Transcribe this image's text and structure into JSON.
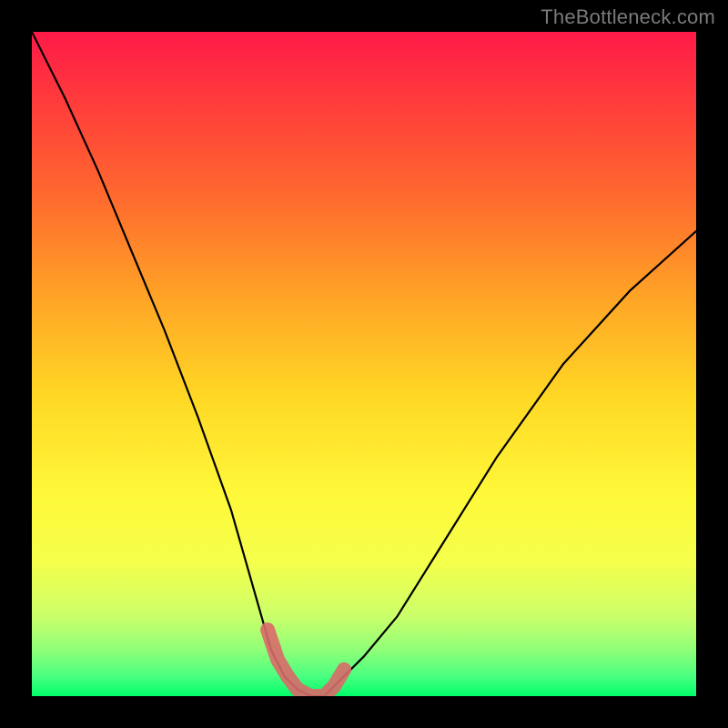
{
  "watermark": "TheBottleneck.com",
  "chart_data": {
    "type": "line",
    "title": "",
    "xlabel": "",
    "ylabel": "",
    "xlim": [
      0,
      100
    ],
    "ylim": [
      0,
      100
    ],
    "grid": false,
    "legend": false,
    "background_gradient": {
      "top": "#ff1a48",
      "mid": "#fff93a",
      "bottom": "#00ff6a"
    },
    "series": [
      {
        "name": "bottleneck-curve",
        "x": [
          0,
          5,
          10,
          15,
          20,
          25,
          30,
          32,
          34,
          36,
          38,
          40,
          42,
          44,
          46,
          50,
          55,
          60,
          65,
          70,
          80,
          90,
          100
        ],
        "values": [
          100,
          90,
          79,
          67,
          55,
          42,
          28,
          21,
          14,
          7,
          3,
          1,
          0,
          0,
          2,
          6,
          12,
          20,
          28,
          36,
          50,
          61,
          70
        ]
      }
    ],
    "marker_points": {
      "name": "highlighted-optimal-range",
      "x": [
        35.5,
        37,
        38.5,
        40,
        42,
        44,
        45.5,
        47
      ],
      "values": [
        10,
        5.5,
        3,
        1,
        0,
        0,
        1.5,
        4
      ]
    }
  }
}
